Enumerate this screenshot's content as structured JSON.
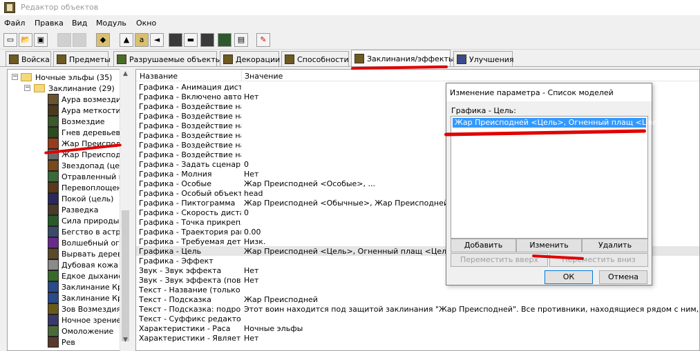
{
  "window": {
    "title": "Редактор объектов"
  },
  "menu": [
    "Файл",
    "Правка",
    "Вид",
    "Модуль",
    "Окно"
  ],
  "toolbar": {
    "buttons": [
      {
        "icon": "new-file-icon"
      },
      {
        "icon": "open-folder-icon"
      },
      {
        "icon": "save-disk-icon"
      },
      {
        "icon": "copy-icon"
      },
      {
        "icon": "paste-icon"
      },
      {
        "icon": "terrain-editor-icon"
      },
      {
        "icon": "object-editor-icon"
      },
      {
        "icon": "ai-editor-icon"
      },
      {
        "icon": "sound-editor-icon"
      },
      {
        "icon": "trigger-editor-icon"
      },
      {
        "icon": "campaign-editor-icon"
      },
      {
        "icon": "import-manager-icon"
      },
      {
        "icon": "unit-icon"
      },
      {
        "icon": "test-map-icon"
      },
      {
        "icon": "edit-check-icon"
      }
    ]
  },
  "tabs": [
    {
      "label": "Войска",
      "active": false
    },
    {
      "label": "Предметы",
      "active": false
    },
    {
      "label": "Разрушаемые объекты",
      "active": false
    },
    {
      "label": "Декорации",
      "active": false
    },
    {
      "label": "Способности",
      "active": false
    },
    {
      "label": "Заклинания/эффекты",
      "active": true
    },
    {
      "label": "Улучшения",
      "active": false
    }
  ],
  "tree": {
    "root": "Ночные эльфы (35)",
    "folder": "Заклинание (29)",
    "items": [
      "Аура возмездия",
      "Аура меткости",
      "Возмездие",
      "Гнев деревьев",
      "Жар Преисподней",
      "Жар Преисподне",
      "Звездопад (цель",
      "Отравленный но",
      "Перевоплощени",
      "Покой (цель)",
      "Разведка",
      "Сила природы",
      "Бегство в астра",
      "Волшебный огон",
      "Вырвать дерево",
      "Дубовая кожа",
      "Едкое дыхание",
      "Заклинание Кро",
      "Заклинание Кро",
      "Зов Возмездия",
      "Ночное зрение",
      "Омоложение",
      "Рев"
    ],
    "colors": [
      "#6a5330",
      "#4b3a1e",
      "#3a5a2a",
      "#2e4a20",
      "#9a3b1a",
      "#6a6a6a",
      "#7a4a1a",
      "#3a6a3a",
      "#5a3a1a",
      "#2a2a5a",
      "#4a3a2a",
      "#2a5a2a",
      "#3a4a6a",
      "#6a2a8a",
      "#5a4a2a",
      "#8a8a8a",
      "#3a6a2a",
      "#2a4a8a",
      "#2a4a8a",
      "#6a5a1a",
      "#3a3a6a",
      "#4a6a3a",
      "#5a3a2a"
    ]
  },
  "grid": {
    "headers": {
      "name": "Название",
      "value": "Значение"
    },
    "rows": [
      {
        "name": "Графика - Анимация дист...",
        "value": ""
      },
      {
        "name": "Графика - Включено авто...",
        "value": "Нет"
      },
      {
        "name": "Графика - Воздействие на...",
        "value": ""
      },
      {
        "name": "Графика - Воздействие на...",
        "value": ""
      },
      {
        "name": "Графика - Воздействие на...",
        "value": ""
      },
      {
        "name": "Графика - Воздействие на...",
        "value": ""
      },
      {
        "name": "Графика - Воздействие на...",
        "value": ""
      },
      {
        "name": "Графика - Воздействие на...",
        "value": ""
      },
      {
        "name": "Графика - Задать сценари...",
        "value": "0"
      },
      {
        "name": "Графика - Молния",
        "value": "Нет"
      },
      {
        "name": "Графика - Особые",
        "value": "Жар Преисподней <Особые>, ..."
      },
      {
        "name": "Графика - Особый объект ...",
        "value": "head"
      },
      {
        "name": "Графика - Пиктограмма",
        "value": "Жар Преисподней <Обычные>, Жар Преисподней <Иссле"
      },
      {
        "name": "Графика - Скорость диста...",
        "value": "0"
      },
      {
        "name": "Графика - Точка прикрепл...",
        "value": ""
      },
      {
        "name": "Графика - Траектория рак...",
        "value": "0.00"
      },
      {
        "name": "Графика - Требуемая дета...",
        "value": "Низк."
      },
      {
        "name": "Графика - Цель",
        "value": "Жар Преисподней <Цель>, Огненный плащ <Цель>"
      },
      {
        "name": "Графика - Эффект",
        "value": ""
      },
      {
        "name": "Звук - Звук эффекта",
        "value": "Нет"
      },
      {
        "name": "Звук - Звук эффекта (повт...",
        "value": "Нет"
      },
      {
        "name": "Текст - Название (только ...",
        "value": ""
      },
      {
        "name": "Текст - Подсказка",
        "value": "Жар Преисподней"
      },
      {
        "name": "Текст - Подсказка: подро...",
        "value": "Этот воин находится под защитой заклинания \"Жар Преисподней\". Все противники, находящиеся рядом с ним, непрерывно теря"
      },
      {
        "name": "Текст - Суффикс редактора",
        "value": ""
      },
      {
        "name": "Характеристики - Раса",
        "value": "Ночные эльфы"
      },
      {
        "name": "Характеристики - Являетс...",
        "value": "Нет"
      }
    ],
    "highlighted_row": 17
  },
  "dialog": {
    "title": "Изменение параметра  - Список моделей",
    "field_label": "Графика - Цель:",
    "list_items": [
      "Жар Преисподней <Цель>, Огненный плащ <Цель>"
    ],
    "buttons": {
      "add": "Добавить",
      "edit": "Изменить",
      "delete": "Удалить",
      "move_up": "Переместить вверх",
      "move_down": "Переместить вниз",
      "ok": "ОК",
      "cancel": "Отмена"
    }
  },
  "colors": {
    "selection": "#3399ff",
    "annotation_red": "#e00000",
    "row_highlight": "#e6e6e6"
  }
}
